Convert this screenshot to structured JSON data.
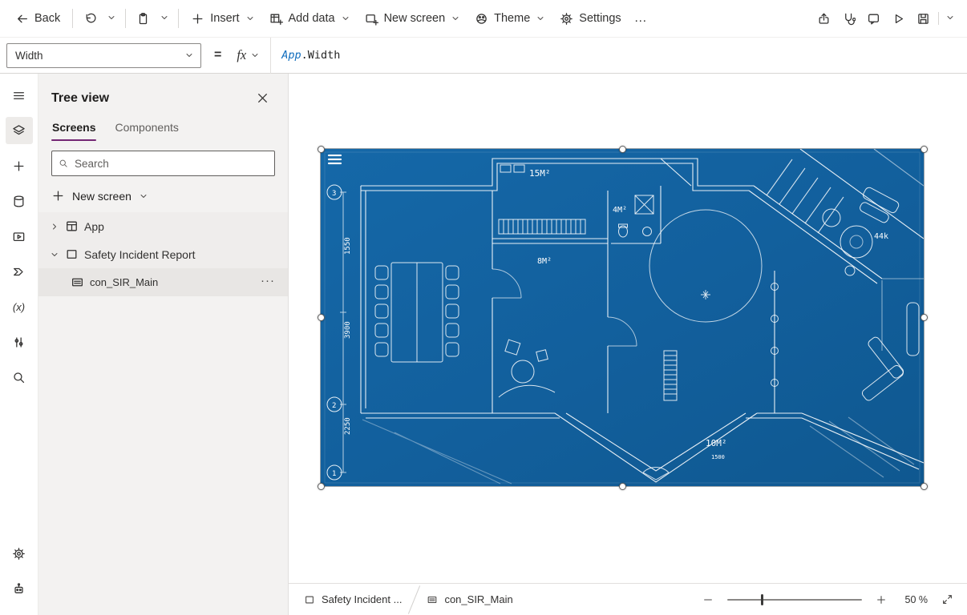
{
  "topbar": {
    "back_label": "Back",
    "insert_label": "Insert",
    "add_data_label": "Add data",
    "new_screen_label": "New screen",
    "theme_label": "Theme",
    "settings_label": "Settings",
    "overflow_label": "…"
  },
  "formula_bar": {
    "property_selected": "Width",
    "equals_sign": "=",
    "fx_label": "fx",
    "formula_app": "App",
    "formula_rest": ".Width"
  },
  "tree_panel": {
    "title": "Tree view",
    "tab_screens": "Screens",
    "tab_components": "Components",
    "search_placeholder": "Search",
    "new_screen_label": "New screen",
    "item_app": "App",
    "item_screen": "Safety Incident Report",
    "item_container": "con_SIR_Main",
    "overflow": "···"
  },
  "canvas": {
    "labels": {
      "area_top": "15M²",
      "area_small": "4M²",
      "area_mid": "8M²",
      "area_bottom": "10M²",
      "annotation_right": "44k",
      "dim_left_1": "1550",
      "dim_left_2": "3900",
      "dim_left_3": "2250",
      "dim_bottom": "1500",
      "grid_3": "3",
      "grid_2": "2",
      "grid_1": "1"
    }
  },
  "bottom_bar": {
    "crumb_screen": "Safety Incident ...",
    "crumb_container": "con_SIR_Main",
    "zoom_value": "50 %"
  }
}
